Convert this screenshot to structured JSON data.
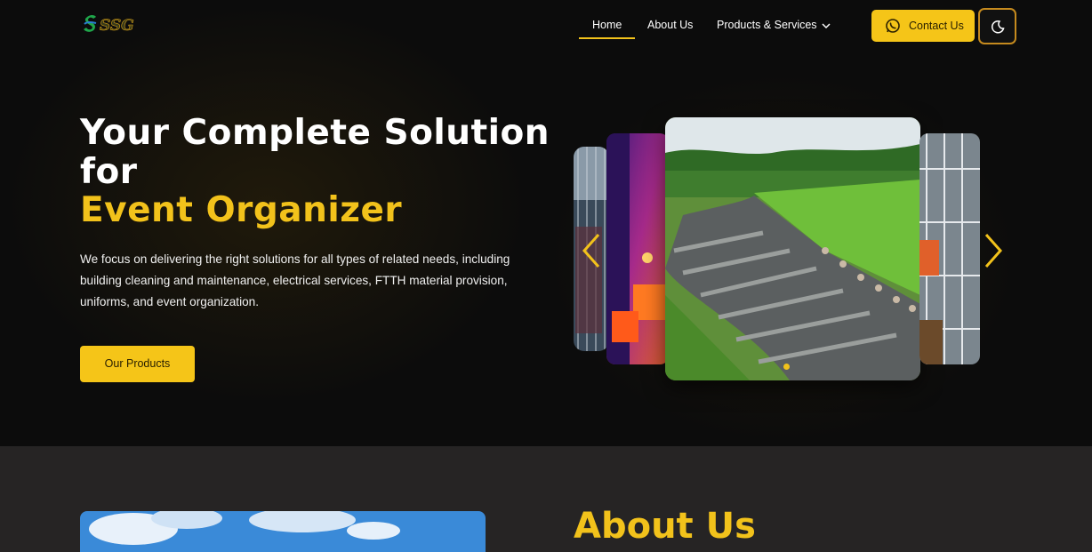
{
  "brand": {
    "logo_text": "SSG"
  },
  "nav": {
    "items": [
      {
        "label": "Home",
        "active": true
      },
      {
        "label": "About Us"
      },
      {
        "label": "Products & Services"
      }
    ],
    "contact_label": "Contact Us",
    "icons": [
      "whatsapp-icon",
      "moon-icon",
      "chevron-down-icon"
    ]
  },
  "hero": {
    "title_line1": "Your Complete Solution",
    "title_line2": "for",
    "title_line3": "Event Organizer",
    "description": "We focus on delivering the right solutions for all types of related needs, including building cleaning and maintenance, electrical services, FTTH material provision, uniforms, and event organization.",
    "cta_label": "Our Products"
  },
  "carousel": {
    "active_index": 0,
    "slides_visible": [
      "building-facade",
      "event-hall",
      "garden-pathway",
      "scaffolding-worker"
    ],
    "dots_count": 1
  },
  "about": {
    "title": "About Us"
  },
  "colors": {
    "accent": "#f5c518",
    "background": "#0c0c0c",
    "section_bg": "#262424"
  }
}
